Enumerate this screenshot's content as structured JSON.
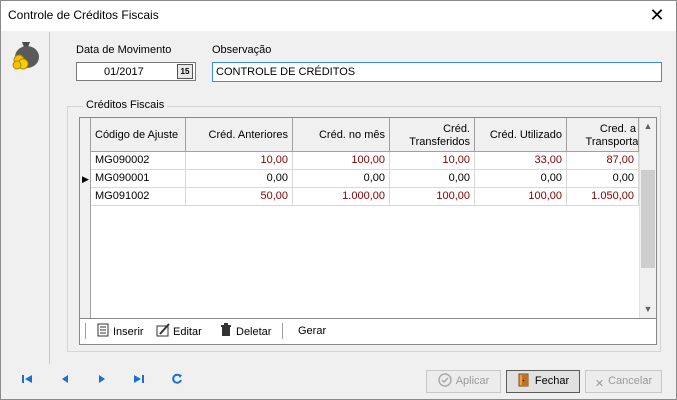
{
  "window": {
    "title": "Controle de Créditos Fiscais"
  },
  "form": {
    "data_movimento_label": "Data de Movimento",
    "data_movimento_value": "01/2017",
    "calendar_glyph": "15",
    "observacao_label": "Observação",
    "observacao_value": "CONTROLE DE CRÉDITOS"
  },
  "creditos": {
    "group_label": "Créditos Fiscais",
    "columns": {
      "codigo": "Código de Ajuste",
      "anteriores": "Créd. Anteriores",
      "mes": "Créd. no mês",
      "transferidos_1": "Créd.",
      "transferidos_2": "Transferidos",
      "utilizado": "Créd. Utilizado",
      "transportar_1": "Cred. a",
      "transportar_2": "Transportar"
    },
    "rows": [
      {
        "codigo": "MG090002",
        "anteriores": "10,00",
        "mes": "100,00",
        "transferidos": "10,00",
        "utilizado": "33,00",
        "transportar": "87,00"
      },
      {
        "codigo": "MG090001",
        "anteriores": "0,00",
        "mes": "0,00",
        "transferidos": "0,00",
        "utilizado": "0,00",
        "transportar": "0,00"
      },
      {
        "codigo": "MG091002",
        "anteriores": "50,00",
        "mes": "1.000,00",
        "transferidos": "100,00",
        "utilizado": "100,00",
        "transportar": "1.050,00"
      }
    ],
    "current_row_marker": "▶"
  },
  "toolbar": {
    "inserir": "Inserir",
    "editar": "Editar",
    "deletar": "Deletar",
    "gerar": "Gerar"
  },
  "buttons": {
    "aplicar": "Aplicar",
    "fechar": "Fechar",
    "cancelar": "Cancelar"
  },
  "icons": {
    "window": "money-bag-icon",
    "first": "first-record-icon",
    "prev": "previous-record-icon",
    "next": "next-record-icon",
    "last": "last-record-icon",
    "refresh": "refresh-icon"
  },
  "colors": {
    "value_text": "#800000",
    "nav_blue": "#1a6fd1",
    "focus_border": "#3a8ed8"
  }
}
